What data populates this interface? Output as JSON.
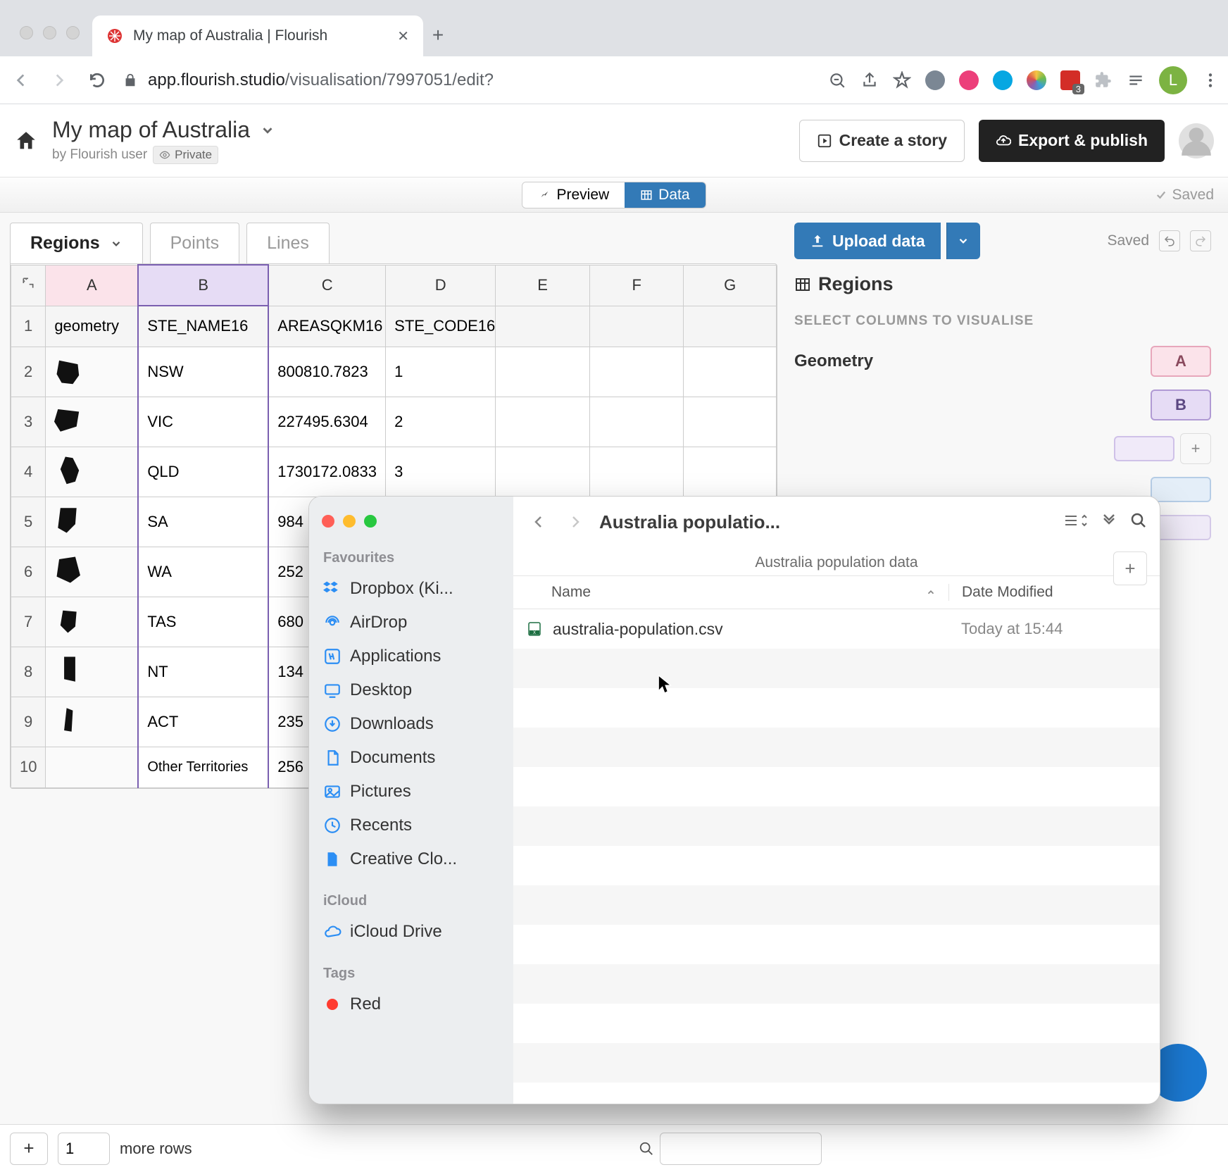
{
  "browser": {
    "tab_title": "My map of Australia | Flourish",
    "url_host": "app.flourish.studio",
    "url_path": "/visualisation/7997051/edit?",
    "avatar_letter": "L",
    "lastpass_badge": "3"
  },
  "app": {
    "project_title": "My map of Australia",
    "author_prefix": "by Flourish user",
    "privacy": "Private",
    "create_story": "Create a story",
    "export": "Export & publish",
    "preview": "Preview",
    "data": "Data",
    "saved_label": "Saved"
  },
  "tabs": {
    "regions": "Regions",
    "points": "Points",
    "lines": "Lines"
  },
  "sheet": {
    "cols": [
      "A",
      "B",
      "C",
      "D",
      "E",
      "F",
      "G"
    ],
    "headers": {
      "A": "geometry",
      "B": "STE_NAME16",
      "C": "AREASQKM16",
      "D": "STE_CODE16"
    },
    "rows": [
      {
        "n": "1"
      },
      {
        "n": "2",
        "B": "NSW",
        "C": "800810.7823",
        "D": "1"
      },
      {
        "n": "3",
        "B": "VIC",
        "C": "227495.6304",
        "D": "2"
      },
      {
        "n": "4",
        "B": "QLD",
        "C": "1730172.0833",
        "D": "3"
      },
      {
        "n": "5",
        "B": "SA",
        "C": "984",
        "D": ""
      },
      {
        "n": "6",
        "B": "WA",
        "C": "252",
        "D": ""
      },
      {
        "n": "7",
        "B": "TAS",
        "C": "680",
        "D": ""
      },
      {
        "n": "8",
        "B": "NT",
        "C": "134",
        "D": ""
      },
      {
        "n": "9",
        "B": "ACT",
        "C": "235",
        "D": ""
      },
      {
        "n": "10",
        "B": "Other Territories",
        "C": "256",
        "D": ""
      }
    ]
  },
  "right": {
    "upload": "Upload data",
    "saved": "Saved",
    "section_title": "Regions",
    "select_cols": "SELECT COLUMNS TO VISUALISE",
    "geometry_label": "Geometry",
    "geometry_col": "A",
    "name_col": "B"
  },
  "footer": {
    "rows_value": "1",
    "more_rows": "more rows"
  },
  "finder": {
    "title": "Australia populatio...",
    "subtitle": "Australia population data",
    "col_name": "Name",
    "col_date": "Date Modified",
    "favourites_header": "Favourites",
    "favourites": [
      "Dropbox (Ki...",
      "AirDrop",
      "Applications",
      "Desktop",
      "Downloads",
      "Documents",
      "Pictures",
      "Recents",
      "Creative Clo..."
    ],
    "icloud_header": "iCloud",
    "icloud": "iCloud Drive",
    "tags_header": "Tags",
    "tag_red": "Red",
    "file_name": "australia-population.csv",
    "file_date": "Today at 15:44"
  }
}
